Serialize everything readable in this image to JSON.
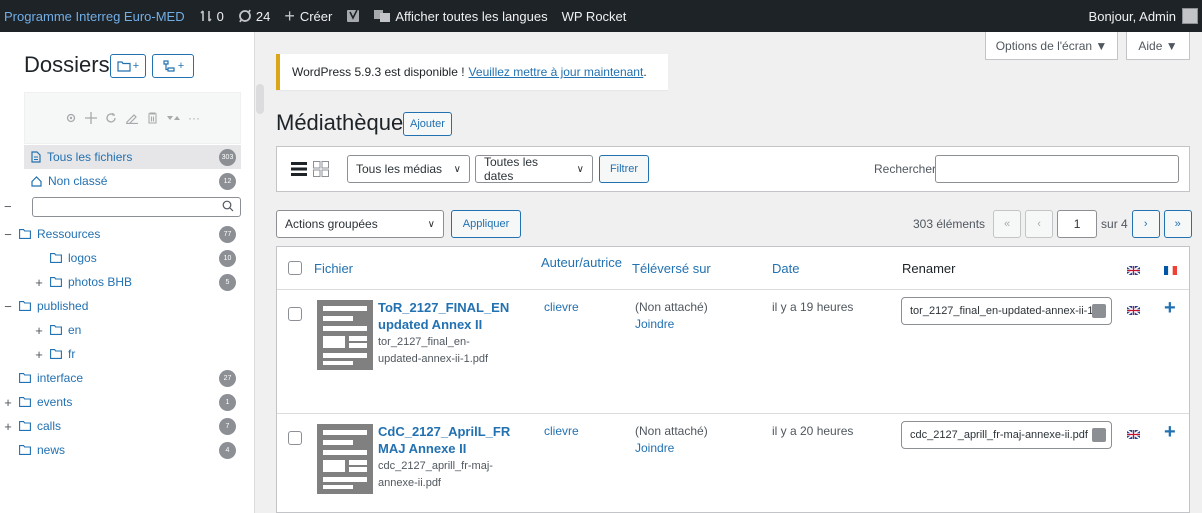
{
  "adminbar": {
    "site_name": "Programme Interreg Euro-MED",
    "revisions_count": "0",
    "updates_count": "24",
    "create_label": "Créer",
    "languages_label": "Afficher toutes les langues",
    "rocket_label": "WP Rocket",
    "greeting": "Bonjour, Admin"
  },
  "folders": {
    "title": "Dossiers",
    "all_files": {
      "label": "Tous les fichiers",
      "count": "303"
    },
    "unclassified": {
      "label": "Non classé",
      "count": "12"
    },
    "tree": [
      {
        "label": "Ressources",
        "count": "77",
        "expander": "−"
      },
      {
        "label": "logos",
        "count": "10",
        "expander": ""
      },
      {
        "label": "photos BHB",
        "count": "5",
        "expander": "+"
      },
      {
        "label": "published",
        "count": "",
        "expander": "−"
      },
      {
        "label": "en",
        "count": "",
        "expander": "+"
      },
      {
        "label": "fr",
        "count": "",
        "expander": "+"
      },
      {
        "label": "interface",
        "count": "27",
        "expander": ""
      },
      {
        "label": "events",
        "count": "1",
        "expander": "+"
      },
      {
        "label": "calls",
        "count": "7",
        "expander": "+"
      },
      {
        "label": "news",
        "count": "4",
        "expander": ""
      }
    ]
  },
  "screen_options": {
    "options_label": "Options de l'écran ▼",
    "help_label": "Aide ▼"
  },
  "notice": {
    "text": "WordPress 5.9.3 est disponible !",
    "link": "Veuillez mettre à jour maintenant",
    "suffix": "."
  },
  "main": {
    "title": "Médiathèque",
    "add_label": "Ajouter",
    "filters": {
      "media_type": "Tous les médias",
      "dates": "Toutes les dates",
      "filter_label": "Filtrer",
      "search_label": "Rechercher",
      "search_value": ""
    },
    "bulk": {
      "action": "Actions groupées",
      "apply_label": "Appliquer"
    },
    "pagination": {
      "items": "303 éléments",
      "first": "«",
      "prev": "‹",
      "current": "1",
      "of": "sur 4",
      "next": "›",
      "last": "»"
    },
    "columns": {
      "file": "Fichier",
      "author": "Auteur/autrice",
      "uploaded_to": "Téléversé sur",
      "date": "Date",
      "rename": "Renamer"
    },
    "rows": [
      {
        "title": "ToR_2127_FINAL_EN updated Annex II",
        "filename": "tor_2127_final_en-updated-annex-ii-1.pdf",
        "author": "clievre",
        "attached": "(Non attaché)",
        "attach_link": "Joindre",
        "date": "il y a 19 heures",
        "rename_value": "tor_2127_final_en-updated-annex-ii-1"
      },
      {
        "title": "CdC_2127_AprilL_FR MAJ Annexe II",
        "filename": "cdc_2127_aprill_fr-maj-annexe-ii.pdf",
        "author": "clievre",
        "attached": "(Non attaché)",
        "attach_link": "Joindre",
        "date": "il y a 20 heures",
        "rename_value": "cdc_2127_aprill_fr-maj-annexe-ii.pdf"
      }
    ],
    "plus_label": "+"
  },
  "colors": {
    "accent": "#2271b1",
    "adminbar": "#1d2327",
    "notice": "#dba617",
    "badge": "#8c8f94"
  }
}
